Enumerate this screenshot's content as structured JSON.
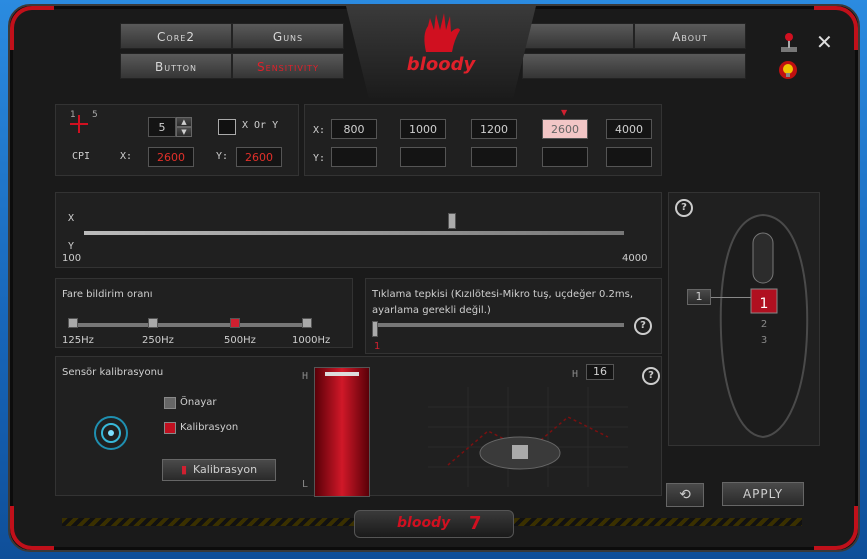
{
  "tabs": [
    {
      "label": "Core2"
    },
    {
      "label": "Guns"
    },
    {
      "label": "Button"
    },
    {
      "label": "Sensitivity"
    },
    {
      "label": ""
    },
    {
      "label": "About"
    },
    {
      "label": ""
    }
  ],
  "logo": "bloody",
  "footer_logo": "bloody",
  "footer_num": "7",
  "dpi": {
    "levels_label_left": "1",
    "levels_label_right": "5",
    "level": "5",
    "xy_label": "X Or Y",
    "cpi_label": "CPI",
    "x_label": "X:",
    "y_label": "Y:",
    "x_value": "2600",
    "y_value": "2600",
    "row_x_label": "X:",
    "row_y_label": "Y:",
    "x_values": [
      "800",
      "1000",
      "1200",
      "2600",
      "4000"
    ]
  },
  "xy_slider": {
    "x_label": "X",
    "y_label": "Y",
    "min": "100",
    "max": "4000"
  },
  "report_rate": {
    "title": "Fare bildirim oranı",
    "options": [
      "125Hz",
      "250Hz",
      "500Hz",
      "1000Hz"
    ],
    "selected": "500Hz"
  },
  "click_response": {
    "title_line1": "Tıklama tepkisi (Kızılötesi-Mikro tuş, uçdeğer 0.2ms,",
    "title_line2": "ayarlama gerekli değil.)",
    "value": "1"
  },
  "calibration": {
    "title": "Sensör kalibrasyonu",
    "preset_label": "Önayar",
    "calib_label": "Kalibrasyon",
    "button": "Kalibrasyon",
    "h_label": "H",
    "l_label": "L",
    "h_value": "16"
  },
  "mouse_panel": {
    "button_num": "1",
    "help": "?"
  },
  "apply_button": "APPLY",
  "help": "?"
}
